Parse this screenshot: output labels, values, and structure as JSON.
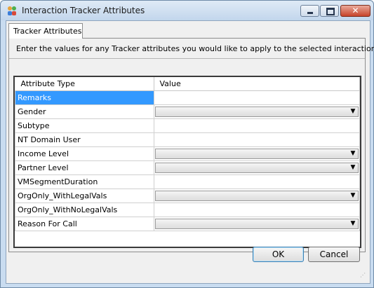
{
  "window": {
    "title": "Interaction Tracker Attributes",
    "close_glyph": "✕"
  },
  "tab": {
    "label": "Tracker Attributes"
  },
  "instructions": "Enter the values for any Tracker attributes you would like to apply to the selected interaction.",
  "grid": {
    "headers": {
      "attribute": "Attribute Type",
      "value": "Value"
    },
    "rows": [
      {
        "label": "Remarks",
        "kind": "text",
        "selected": true
      },
      {
        "label": "Gender",
        "kind": "combo"
      },
      {
        "label": "Subtype",
        "kind": "text"
      },
      {
        "label": "NT Domain User",
        "kind": "text"
      },
      {
        "label": "Income Level",
        "kind": "combo"
      },
      {
        "label": "Partner Level",
        "kind": "combo"
      },
      {
        "label": "VMSegmentDuration",
        "kind": "text"
      },
      {
        "label": "OrgOnly_WithLegalVals",
        "kind": "combo"
      },
      {
        "label": "OrgOnly_WithNoLegalVals",
        "kind": "text"
      },
      {
        "label": "Reason For Call",
        "kind": "combo"
      }
    ]
  },
  "buttons": {
    "ok": "OK",
    "cancel": "Cancel"
  },
  "colors": {
    "selection": "#3399ff",
    "title_bar": "#c9dcf0"
  }
}
